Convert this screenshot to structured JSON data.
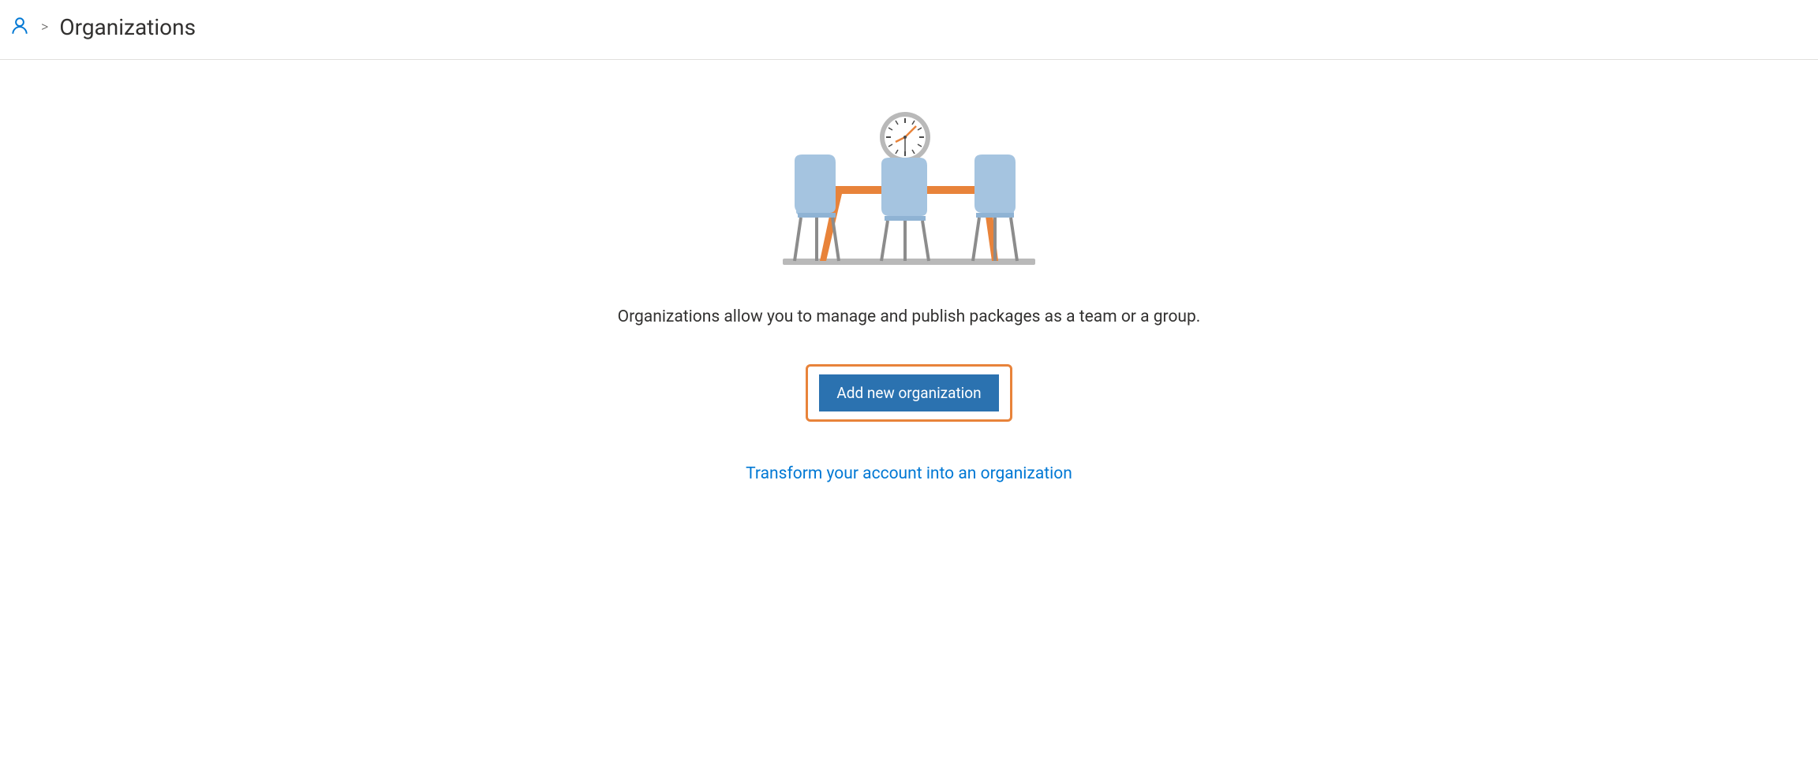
{
  "breadcrumb": {
    "page_title": "Organizations",
    "separator": ">"
  },
  "main": {
    "description": "Organizations allow you to manage and publish packages as a team or a group.",
    "add_button_label": "Add new organization",
    "transform_link_label": "Transform your account into an organization"
  }
}
